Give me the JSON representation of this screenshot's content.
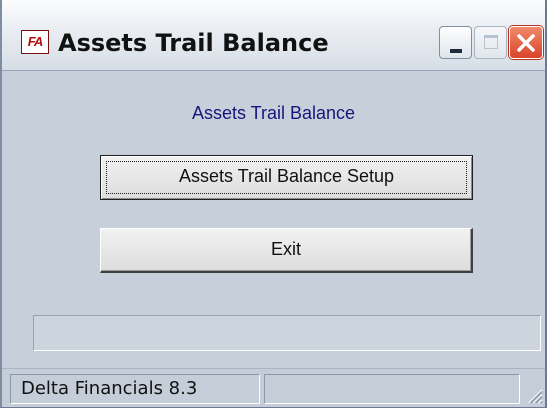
{
  "window": {
    "icon_text": "FA",
    "title": "Assets Trail Balance"
  },
  "main": {
    "heading": "Assets Trail Balance",
    "setup_button_label": "Assets Trail Balance Setup",
    "exit_button_label": "Exit"
  },
  "statusbar": {
    "version_text": "Delta Financials 8.3",
    "secondary_text": ""
  },
  "icons": {
    "app": "app-fa-icon",
    "minimize": "minimize-icon",
    "maximize": "maximize-icon",
    "close": "close-icon",
    "resize": "resize-grip-icon"
  },
  "colors": {
    "heading": "#16167a",
    "close_button": "#d9442a",
    "background": "#c7d0da"
  }
}
